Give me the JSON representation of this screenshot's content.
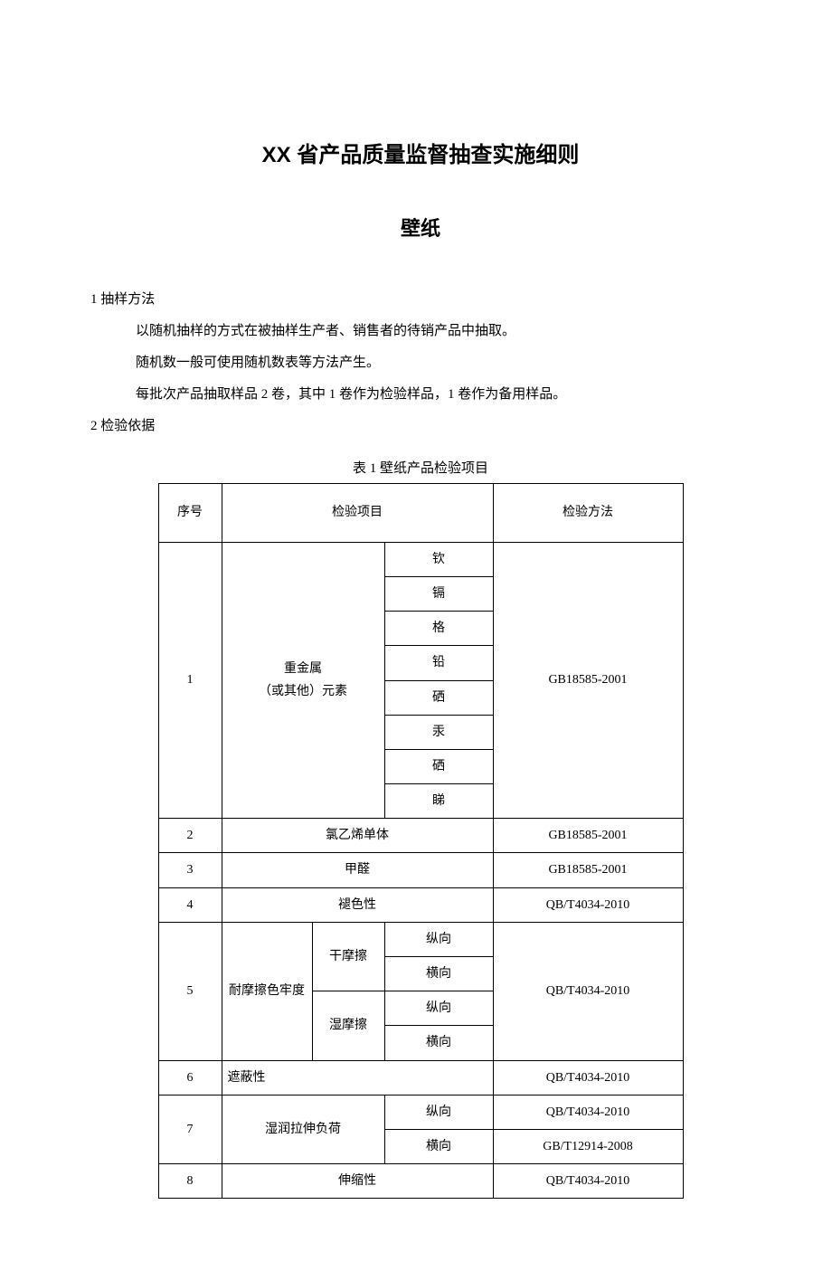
{
  "title": "XX 省产品质量监督抽查实施细则",
  "subtitle": "壁纸",
  "s1": {
    "head": "1 抽样方法",
    "p1": "以随机抽样的方式在被抽样生产者、销售者的待销产品中抽取。",
    "p2": "随机数一般可使用随机数表等方法产生。",
    "p3": "每批次产品抽取样品 2 卷，其中 1 卷作为检验样品，1 卷作为备用样品。"
  },
  "s2": {
    "head": "2 检验依据",
    "caption": "表 1 壁纸产品检验项目",
    "headers": {
      "idx": "序号",
      "item": "检验项目",
      "method": "检验方法"
    },
    "row1": {
      "idx": "1",
      "item": "重金属",
      "item2": "（或其他）元素",
      "subs": [
        "钦",
        "镉",
        "格",
        "铅",
        "硒",
        "汞",
        "硒",
        "睇"
      ],
      "method": "GB18585-2001"
    },
    "row2": {
      "idx": "2",
      "item": "氯乙烯单体",
      "method": "GB18585-2001"
    },
    "row3": {
      "idx": "3",
      "item": "甲醛",
      "method": "GB18585-2001"
    },
    "row4": {
      "idx": "4",
      "item": "褪色性",
      "method": "QB/T4034-2010"
    },
    "row5": {
      "idx": "5",
      "group": "耐摩擦色牢度",
      "sub1": "干摩擦",
      "sub2": "湿摩擦",
      "dir1": "纵向",
      "dir2": "横向",
      "dir3": "纵向",
      "dir4": "横向",
      "method": "QB/T4034-2010"
    },
    "row6": {
      "idx": "6",
      "item": "遮蔽性",
      "method": "QB/T4034-2010"
    },
    "row7": {
      "idx": "7",
      "item": "湿润拉伸负荷",
      "dir1": "纵向",
      "dir2": "横向",
      "method1": "QB/T4034-2010",
      "method2": "GB/T12914-2008"
    },
    "row8": {
      "idx": "8",
      "item": "伸缩性",
      "method": "QB/T4034-2010"
    }
  }
}
